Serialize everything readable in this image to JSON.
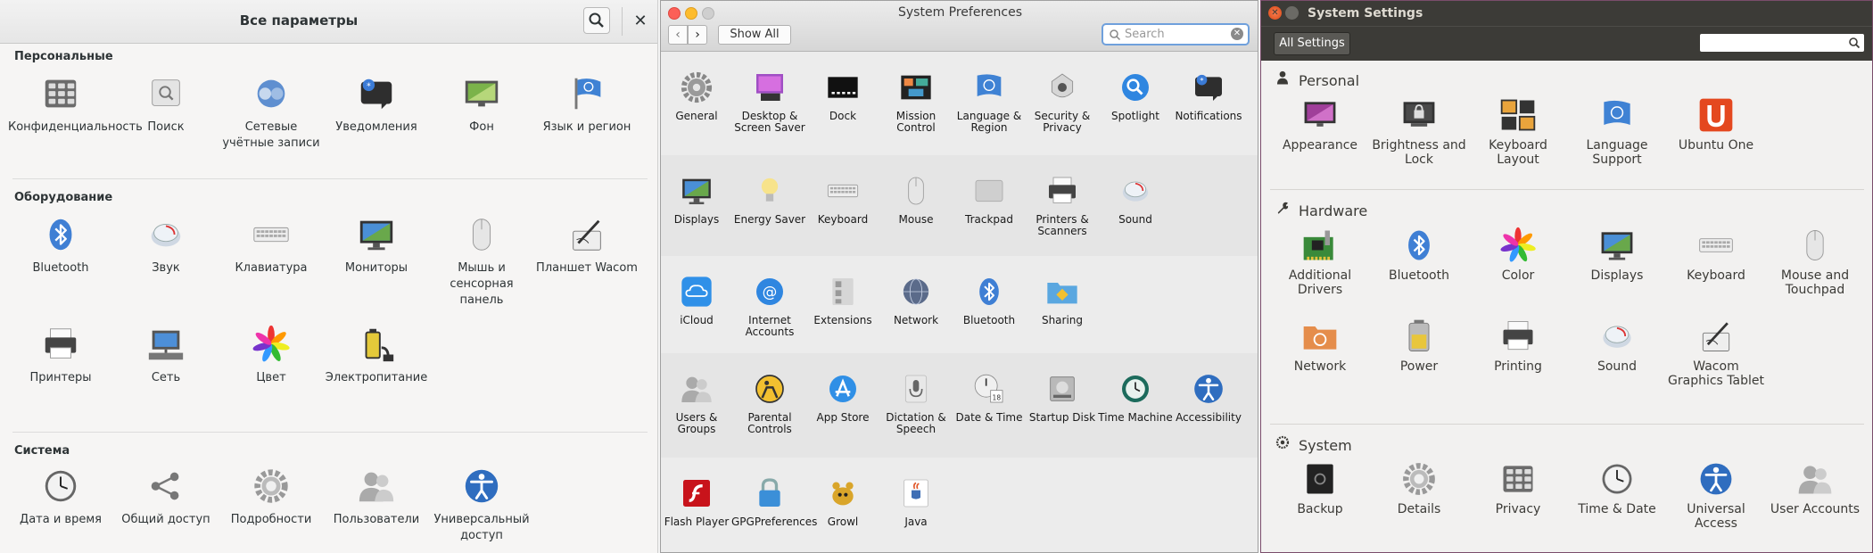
{
  "gnome": {
    "title": "Все параметры",
    "sections": [
      {
        "title": "Персональные",
        "items": [
          {
            "label": "Конфиденциальность",
            "icon": "privacy-icon"
          },
          {
            "label": "Поиск",
            "icon": "search-icon"
          },
          {
            "label": "Сетевые учётные записи",
            "icon": "online-accounts-icon"
          },
          {
            "label": "Уведомления",
            "icon": "notifications-icon"
          },
          {
            "label": "Фон",
            "icon": "background-icon"
          },
          {
            "label": "Язык и регион",
            "icon": "region-flag-icon"
          }
        ]
      },
      {
        "title": "Оборудование",
        "items": [
          {
            "label": "Bluetooth",
            "icon": "bluetooth-icon"
          },
          {
            "label": "Звук",
            "icon": "sound-icon"
          },
          {
            "label": "Клавиатура",
            "icon": "keyboard-icon"
          },
          {
            "label": "Мониторы",
            "icon": "displays-icon"
          },
          {
            "label": "Мышь и сенсорная панель",
            "icon": "mouse-icon"
          },
          {
            "label": "Планшет Wacom",
            "icon": "wacom-icon"
          },
          {
            "label": "Принтеры",
            "icon": "printer-icon"
          },
          {
            "label": "Сеть",
            "icon": "network-icon"
          },
          {
            "label": "Цвет",
            "icon": "color-icon"
          },
          {
            "label": "Электропитание",
            "icon": "power-icon"
          }
        ]
      },
      {
        "title": "Система",
        "items": [
          {
            "label": "Дата и время",
            "icon": "clock-icon"
          },
          {
            "label": "Общий доступ",
            "icon": "sharing-icon"
          },
          {
            "label": "Подробности",
            "icon": "details-gear-icon"
          },
          {
            "label": "Пользователи",
            "icon": "users-icon"
          },
          {
            "label": "Универсальный доступ",
            "icon": "accessibility-icon"
          }
        ]
      }
    ]
  },
  "mac": {
    "title": "System Preferences",
    "show_all": "Show All",
    "search_placeholder": "Search",
    "rows": [
      {
        "items": [
          {
            "label": "General",
            "icon": "general-icon"
          },
          {
            "label": "Desktop & Screen Saver",
            "icon": "desktop-icon"
          },
          {
            "label": "Dock",
            "icon": "dock-icon"
          },
          {
            "label": "Mission Control",
            "icon": "mission-control-icon"
          },
          {
            "label": "Language & Region",
            "icon": "language-flag-icon"
          },
          {
            "label": "Security & Privacy",
            "icon": "security-icon"
          },
          {
            "label": "Spotlight",
            "icon": "spotlight-icon"
          },
          {
            "label": "Notifications",
            "icon": "notifications-icon"
          }
        ]
      },
      {
        "items": [
          {
            "label": "Displays",
            "icon": "displays-icon"
          },
          {
            "label": "Energy Saver",
            "icon": "energy-bulb-icon"
          },
          {
            "label": "Keyboard",
            "icon": "keyboard-icon"
          },
          {
            "label": "Mouse",
            "icon": "mouse-icon"
          },
          {
            "label": "Trackpad",
            "icon": "trackpad-icon"
          },
          {
            "label": "Printers & Scanners",
            "icon": "printer-icon"
          },
          {
            "label": "Sound",
            "icon": "sound-icon"
          }
        ]
      },
      {
        "items": [
          {
            "label": "iCloud",
            "icon": "icloud-icon"
          },
          {
            "label": "Internet Accounts",
            "icon": "internet-accounts-icon"
          },
          {
            "label": "Extensions",
            "icon": "extensions-icon"
          },
          {
            "label": "Network",
            "icon": "network-globe-icon"
          },
          {
            "label": "Bluetooth",
            "icon": "bluetooth-icon"
          },
          {
            "label": "Sharing",
            "icon": "sharing-folder-icon"
          }
        ]
      },
      {
        "items": [
          {
            "label": "Users & Groups",
            "icon": "users-icon"
          },
          {
            "label": "Parental Controls",
            "icon": "parental-icon"
          },
          {
            "label": "App Store",
            "icon": "app-store-icon"
          },
          {
            "label": "Dictation & Speech",
            "icon": "microphone-icon"
          },
          {
            "label": "Date & Time",
            "icon": "calendar-clock-icon"
          },
          {
            "label": "Startup Disk",
            "icon": "disk-icon"
          },
          {
            "label": "Time Machine",
            "icon": "time-machine-icon"
          },
          {
            "label": "Accessibility",
            "icon": "accessibility-icon"
          }
        ]
      },
      {
        "items": [
          {
            "label": "Flash Player",
            "icon": "flash-icon"
          },
          {
            "label": "GPGPreferences",
            "icon": "lock-icon"
          },
          {
            "label": "Growl",
            "icon": "growl-icon"
          },
          {
            "label": "Java",
            "icon": "java-icon"
          }
        ]
      }
    ]
  },
  "ubuntu": {
    "title": "System Settings",
    "all_settings": "All Settings",
    "search_value": "",
    "sections": [
      {
        "title": "Personal",
        "icon": "person-icon",
        "items": [
          {
            "label": "Appearance",
            "icon": "appearance-icon"
          },
          {
            "label": "Brightness and Lock",
            "icon": "brightness-lock-icon"
          },
          {
            "label": "Keyboard Layout",
            "icon": "keyboard-layout-icon"
          },
          {
            "label": "Language Support",
            "icon": "language-flag-icon"
          },
          {
            "label": "Ubuntu One",
            "icon": "ubuntu-one-icon"
          }
        ]
      },
      {
        "title": "Hardware",
        "icon": "wrench-icon",
        "items": [
          {
            "label": "Additional Drivers",
            "icon": "drivers-icon"
          },
          {
            "label": "Bluetooth",
            "icon": "bluetooth-icon"
          },
          {
            "label": "Color",
            "icon": "color-icon"
          },
          {
            "label": "Displays",
            "icon": "displays-icon"
          },
          {
            "label": "Keyboard",
            "icon": "keyboard-icon"
          },
          {
            "label": "Mouse and Touchpad",
            "icon": "mouse-icon"
          },
          {
            "label": "Network",
            "icon": "network-folder-icon"
          },
          {
            "label": "Power",
            "icon": "battery-icon"
          },
          {
            "label": "Printing",
            "icon": "printer-icon"
          },
          {
            "label": "Sound",
            "icon": "sound-icon"
          },
          {
            "label": "Wacom Graphics Tablet",
            "icon": "wacom-icon"
          }
        ]
      },
      {
        "title": "System",
        "icon": "system-gear-icon",
        "items": [
          {
            "label": "Backup",
            "icon": "backup-safe-icon"
          },
          {
            "label": "Details",
            "icon": "details-gear-icon"
          },
          {
            "label": "Privacy",
            "icon": "privacy-icon"
          },
          {
            "label": "Time & Date",
            "icon": "clock-icon"
          },
          {
            "label": "Universal Access",
            "icon": "accessibility-icon"
          },
          {
            "label": "User Accounts",
            "icon": "users-icon"
          }
        ]
      }
    ]
  }
}
